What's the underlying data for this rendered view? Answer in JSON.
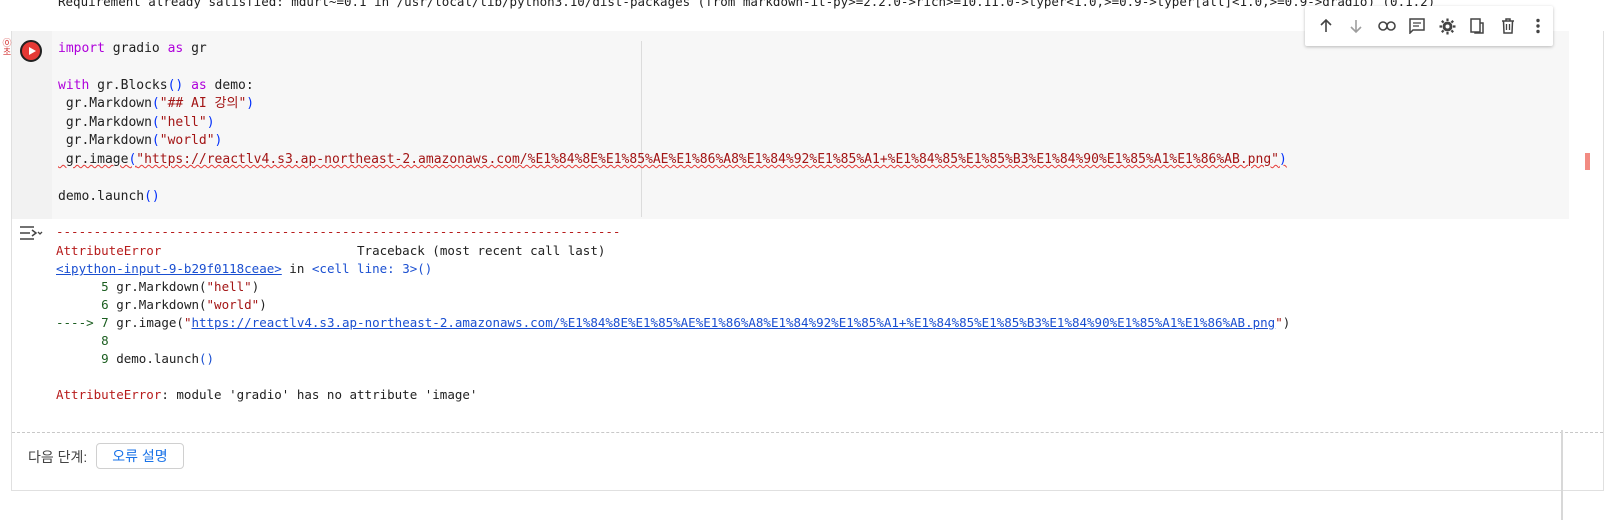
{
  "previous_output": "Requirement already satisfied: mdurl~=0.1 in /usr/local/lib/python3.10/dist-packages (from markdown-it-py>=2.2.0->rich>=10.11.0->typer<1.0,>=0.9->typer[all]<1.0,>=0.9->gradio) (0.1.2)",
  "cell": {
    "error_badge": "①\n초",
    "code": {
      "line1": {
        "kw": "import",
        "rest": " gradio ",
        "kw2": "as",
        "rest2": " gr"
      },
      "line3": {
        "kw": "with",
        "pre": " gr.Blocks",
        "paren": "()",
        "kw2": " as",
        "post": " demo:"
      },
      "line4": {
        "pre": " gr.Markdown",
        "open": "(",
        "str": "\"## AI 강의\"",
        "close": ")"
      },
      "line5": {
        "pre": " gr.Markdown",
        "open": "(",
        "str": "\"hell\"",
        "close": ")"
      },
      "line6": {
        "pre": " gr.Markdown",
        "open": "(",
        "str": "\"world\"",
        "close": ")"
      },
      "line7": {
        "pre": " gr.image",
        "open": "(",
        "str": "\"https://reactlv4.s3.ap-northeast-2.amazonaws.com/%E1%84%8E%E1%85%AE%E1%86%A8%E1%84%92%E1%85%A1+%E1%84%85%E1%85%B3%E1%84%90%E1%85%A1%E1%86%AB.png\"",
        "close": ")"
      },
      "line9": {
        "pre": "demo.launch",
        "paren": "()"
      }
    }
  },
  "toolbar": {
    "icons": [
      "arrow-up-icon",
      "arrow-down-icon",
      "link-icon",
      "comment-icon",
      "gear-icon",
      "mirror-icon",
      "trash-icon",
      "more-vert-icon"
    ]
  },
  "output": {
    "dashes": "---------------------------------------------------------------------------",
    "error_name": "AttributeError",
    "traceback_label": "Traceback (most recent call last)",
    "input_link": "<ipython-input-9-b29f0118ceae>",
    "in_text": " in ",
    "cell_line": "<cell line: 3>",
    "cell_line_paren": "()",
    "tb_lines": [
      {
        "num": "      5 ",
        "code_pre": "gr.Markdown(",
        "str": "\"hell\"",
        "code_post": ")"
      },
      {
        "num": "      6 ",
        "code_pre": "gr.Markdown(",
        "str": "\"world\"",
        "code_post": ")"
      }
    ],
    "arrow_num": "----> 7 ",
    "arrow_pre": "gr.image(",
    "arrow_str_open": "\"",
    "arrow_url": "https://reactlv4.s3.ap-northeast-2.amazonaws.com/%E1%84%8E%E1%85%AE%E1%86%A8%E1%84%92%E1%85%A1+%E1%84%85%E1%85%B3%E1%84%90%E1%85%A1%E1%86%AB.png",
    "arrow_str_close": "\"",
    "arrow_post": ")",
    "line8_num": "      8",
    "line9_num": "      9 ",
    "line9_pre": "demo.launch",
    "line9_paren": "()",
    "final_error_name": "AttributeError",
    "final_error_msg": ": module 'gradio' has no attribute 'image'"
  },
  "next_steps": {
    "label": "다음 단계:",
    "explain_button": "오류 설명"
  },
  "colors": {
    "error_red": "#b71c1c",
    "keyword_purple": "#af00db",
    "link_blue": "#1a4fd1",
    "run_button": "#e53935"
  }
}
